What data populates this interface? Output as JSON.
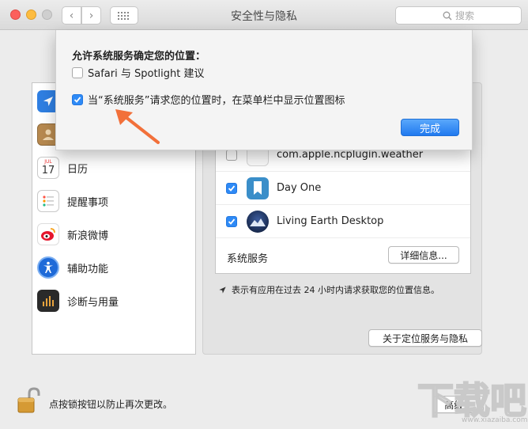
{
  "window": {
    "title": "安全性与隐私"
  },
  "toolbar": {
    "back_icon": "chevron-left-icon",
    "forward_icon": "chevron-right-icon",
    "grid_icon": "grid-icon"
  },
  "search": {
    "placeholder": "搜索"
  },
  "sidebar": {
    "items": [
      {
        "label": "",
        "icon": "location-arrow-icon",
        "selected": true
      },
      {
        "label": "",
        "icon": "contacts-icon"
      },
      {
        "label": "日历",
        "icon": "calendar-icon",
        "date": "17",
        "month": "JUL"
      },
      {
        "label": "提醒事项",
        "icon": "reminders-icon"
      },
      {
        "label": "新浪微博",
        "icon": "weibo-icon"
      },
      {
        "label": "辅助功能",
        "icon": "accessibility-icon"
      },
      {
        "label": "诊断与用量",
        "icon": "diagnostics-icon"
      }
    ]
  },
  "apps": [
    {
      "name": "com.apple.ncplugin.weather",
      "checked": false
    },
    {
      "name": "Day One",
      "checked": true
    },
    {
      "name": "Living Earth Desktop",
      "checked": true
    }
  ],
  "system_services": {
    "label": "系统服务",
    "details_button": "详细信息..."
  },
  "info_text": "表示有应用在过去 24 小时内请求获取您的位置信息。",
  "about_button": "关于定位服务与隐私",
  "lock": {
    "text": "点按锁按钮以防止再次更改。"
  },
  "advanced_button": "高级...",
  "sheet": {
    "title": "允许系统服务确定您的位置：",
    "option1": {
      "label": "Safari 与 Spotlight 建议",
      "checked": false
    },
    "option2": {
      "label": "当“系统服务”请求您的位置时，在菜单栏中显示位置图标",
      "checked": true
    },
    "done_button": "完成"
  },
  "colors": {
    "accent": "#2e8af6",
    "arrow": "#f2703a"
  },
  "watermark": {
    "text": "下载吧",
    "sub": "www.xiazaiba.com"
  }
}
